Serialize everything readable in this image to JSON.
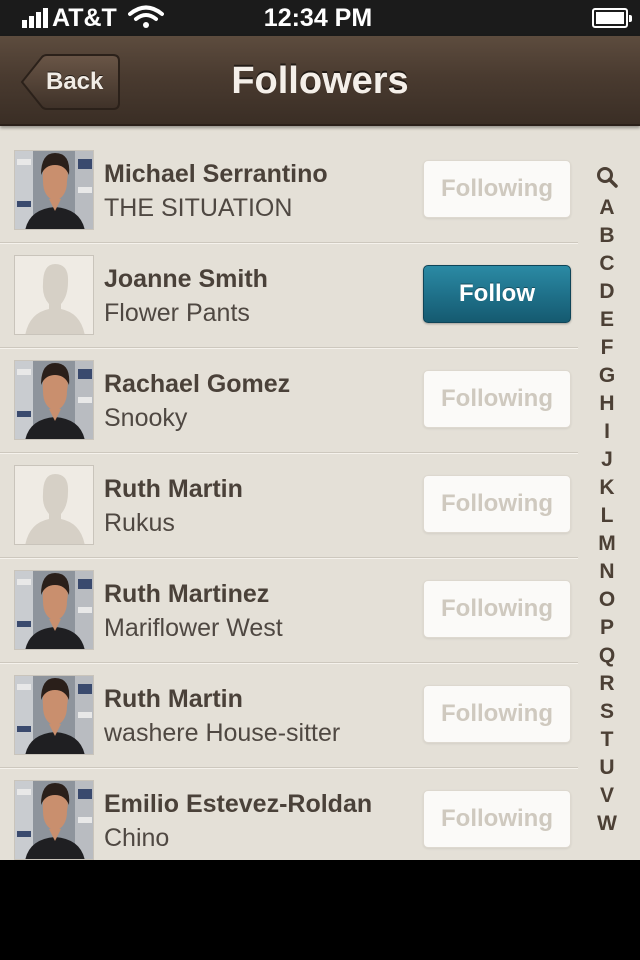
{
  "status_bar": {
    "carrier": "AT&T",
    "time": "12:34 PM",
    "signal_icon": "signal-bars-icon",
    "wifi_icon": "wifi-icon",
    "battery_icon": "battery-icon"
  },
  "nav": {
    "back_label": "Back",
    "title": "Followers"
  },
  "followers": [
    {
      "name": "Michael Serrantino",
      "subtitle": "THE SITUATION",
      "button": "Following",
      "state": "following",
      "avatar": "photo"
    },
    {
      "name": "Joanne Smith",
      "subtitle": "Flower Pants",
      "button": "Follow",
      "state": "follow",
      "avatar": "placeholder"
    },
    {
      "name": "Rachael Gomez",
      "subtitle": "Snooky",
      "button": "Following",
      "state": "following",
      "avatar": "photo"
    },
    {
      "name": "Ruth Martin",
      "subtitle": "Rukus",
      "button": "Following",
      "state": "following",
      "avatar": "placeholder"
    },
    {
      "name": "Ruth Martinez",
      "subtitle": "Mariflower West",
      "button": "Following",
      "state": "following",
      "avatar": "photo"
    },
    {
      "name": "Ruth Martin",
      "subtitle": "washere House-sitter",
      "button": "Following",
      "state": "following",
      "avatar": "photo"
    },
    {
      "name": "Emilio Estevez-Roldan",
      "subtitle": "Chino",
      "button": "Following",
      "state": "following",
      "avatar": "photo"
    }
  ],
  "index": {
    "search_icon": "search-icon",
    "letters": [
      "A",
      "B",
      "C",
      "D",
      "E",
      "F",
      "G",
      "H",
      "I",
      "J",
      "K",
      "L",
      "M",
      "N",
      "O",
      "P",
      "Q",
      "R",
      "S",
      "T",
      "U",
      "V",
      "W"
    ]
  },
  "colors": {
    "nav_background": "#4a3b30",
    "follow_button": "#1e6f88",
    "list_background": "#e4e0d7",
    "name_text": "#4a4139"
  }
}
